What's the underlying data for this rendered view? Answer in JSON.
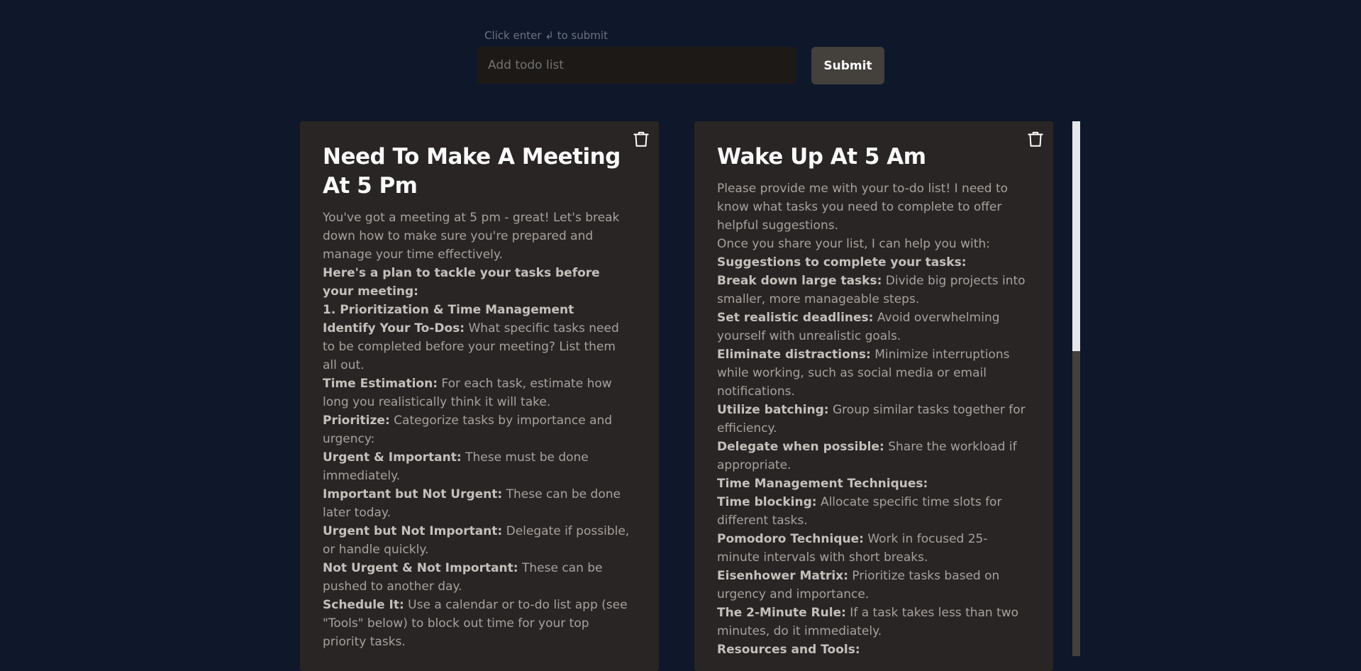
{
  "form": {
    "hint": "Click enter ↲ to submit",
    "placeholder": "Add todo list",
    "submit_label": "Submit"
  },
  "cards": [
    {
      "title": "Need To Make A Meeting At 5 Pm",
      "intro": "You've got a meeting at 5 pm - great! Let's break down how to make sure you're prepared and manage your time effectively.",
      "items": [
        {
          "bold": "Here's a plan to tackle your tasks before your meeting:",
          "text": ""
        },
        {
          "bold": "1. Prioritization & Time Management",
          "text": ""
        },
        {
          "bold": "Identify Your To-Dos:",
          "text": " What specific tasks need to be completed before your meeting? List them all out."
        },
        {
          "bold": "Time Estimation:",
          "text": " For each task, estimate how long you realistically think it will take."
        },
        {
          "bold": "Prioritize:",
          "text": " Categorize tasks by importance and urgency:"
        },
        {
          "bold": "Urgent & Important:",
          "text": " These must be done immediately."
        },
        {
          "bold": "Important but Not Urgent:",
          "text": " These can be done later today."
        },
        {
          "bold": "Urgent but Not Important:",
          "text": " Delegate if possible, or handle quickly."
        },
        {
          "bold": "Not Urgent & Not Important:",
          "text": " These can be pushed to another day."
        },
        {
          "bold": "Schedule It:",
          "text": " Use a calendar or to-do list app (see \"Tools\" below) to block out time for your top priority tasks."
        }
      ]
    },
    {
      "title": "Wake Up At 5 Am",
      "intro": "Please provide me with your to-do list! I need to know what tasks you need to complete to offer helpful suggestions.",
      "items": [
        {
          "bold": "",
          "text": "Once you share your list, I can help you with:"
        },
        {
          "bold": "Suggestions to complete your tasks:",
          "text": ""
        },
        {
          "bold": "Break down large tasks:",
          "text": " Divide big projects into smaller, more manageable steps."
        },
        {
          "bold": "Set realistic deadlines:",
          "text": " Avoid overwhelming yourself with unrealistic goals."
        },
        {
          "bold": "Eliminate distractions:",
          "text": " Minimize interruptions while working, such as social media or email notifications."
        },
        {
          "bold": "Utilize batching:",
          "text": " Group similar tasks together for efficiency."
        },
        {
          "bold": "Delegate when possible:",
          "text": " Share the workload if appropriate."
        },
        {
          "bold": "Time Management Techniques:",
          "text": ""
        },
        {
          "bold": "Time blocking:",
          "text": " Allocate specific time slots for different tasks."
        },
        {
          "bold": "Pomodoro Technique:",
          "text": " Work in focused 25-minute intervals with short breaks."
        },
        {
          "bold": "Eisenhower Matrix:",
          "text": " Prioritize tasks based on urgency and importance."
        },
        {
          "bold": "The 2-Minute Rule:",
          "text": " If a task takes less than two minutes, do it immediately."
        },
        {
          "bold": "Resources and Tools:",
          "text": ""
        }
      ]
    }
  ],
  "scrollbar": {
    "thumb_fraction": 0.43
  },
  "colors": {
    "page_bg": "#0f172a",
    "card_bg": "#292524",
    "input_bg": "#1c1917",
    "button_bg": "#44403c"
  },
  "icons": {
    "delete": "trash-icon"
  }
}
